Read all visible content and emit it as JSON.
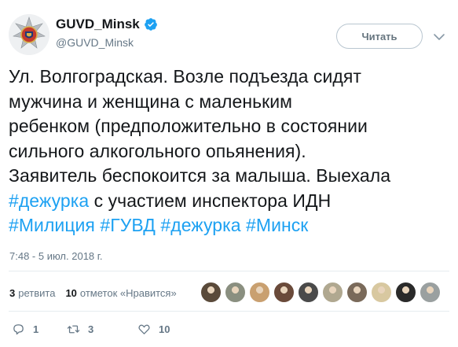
{
  "account": {
    "display_name": "GUVD_Minsk",
    "handle": "@GUVD_Minsk"
  },
  "follow_button_label": "Читать",
  "tweet": {
    "lines": [
      [
        {
          "text": "Ул. Волгоградская. Возле подъезда сидят"
        }
      ],
      [
        {
          "text": "мужчина и женщина с маленьким"
        }
      ],
      [
        {
          "text": "ребенком (предположительно в состоянии"
        }
      ],
      [
        {
          "text": "сильного алкогольного опьянения)."
        }
      ],
      [
        {
          "text": "Заявитель беспокоится за малыша. Выехала"
        }
      ],
      [
        {
          "text": "#дежурка",
          "hashtag": true
        },
        {
          "text": " с участием инспектора ИДН"
        }
      ],
      [
        {
          "text": "#Милиция",
          "hashtag": true
        },
        {
          "text": " "
        },
        {
          "text": "#ГУВД",
          "hashtag": true
        },
        {
          "text": " "
        },
        {
          "text": "#дежурка",
          "hashtag": true
        },
        {
          "text": " "
        },
        {
          "text": "#Минск",
          "hashtag": true
        }
      ]
    ]
  },
  "timestamp": "7:48 - 5 июл. 2018 г.",
  "stats": {
    "retweets_count": "3",
    "retweets_label": "ретвита",
    "likes_count": "10",
    "likes_label": "отметок «Нравится»"
  },
  "liker_avatars": [
    "#5a4a3a",
    "#8a8f80",
    "#c9a070",
    "#6a4a3a",
    "#4a4a4a",
    "#b0a890",
    "#7a6a5a",
    "#d8c8a0",
    "#2a2a2a",
    "#9aa0a0"
  ],
  "actions": {
    "reply_count": "1",
    "retweet_count": "3",
    "like_count": "10"
  },
  "colors": {
    "hashtag": "#1da1f2",
    "verified": "#1da1f2",
    "secondary_text": "#657786"
  }
}
